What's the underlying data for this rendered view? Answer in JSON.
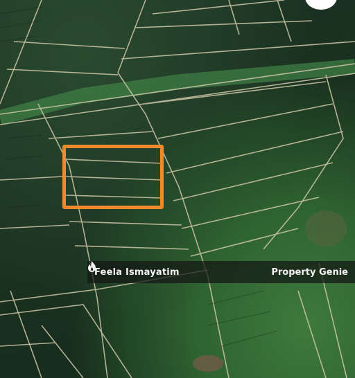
{
  "watermark": {
    "user_name": "Feela Ismayatim",
    "brand_name": "Property Genie",
    "brand_icon": "flame-icon"
  },
  "selection": {
    "color": "#f08a2c"
  },
  "map": {
    "type": "satellite-imagery",
    "palette": {
      "vegetation_dark": "#162b1c",
      "vegetation_light": "#3e7a3c",
      "roads": "#c8c2a6"
    }
  },
  "top_right_button": {
    "icon": "circle-button"
  }
}
